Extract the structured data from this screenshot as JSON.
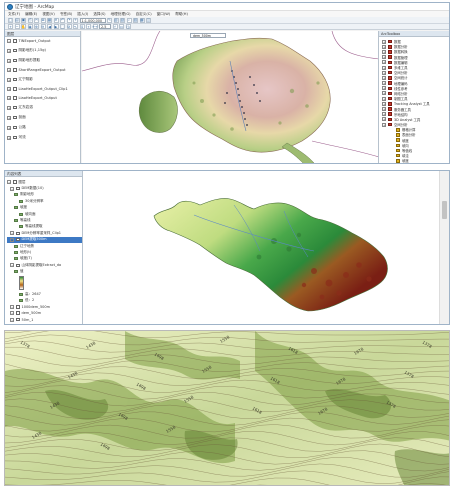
{
  "window": {
    "title": "辽宁地图 - ArcMap"
  },
  "menu": [
    "文件(F)",
    "编辑(E)",
    "视图(V)",
    "书签(B)",
    "插入(I)",
    "选择(S)",
    "地理处理(G)",
    "自定义(C)",
    "窗口(W)",
    "帮助(H)"
  ],
  "toolbar": {
    "scale": "1:1,000,000",
    "zoom_value": "2.5",
    "layer_selector": "dem_500m"
  },
  "toc1": {
    "title": "图层",
    "layers": [
      {
        "label": "TINExport_Output"
      },
      {
        "label": "阴影地形(1,15g)"
      },
      {
        "label": "阴影地形提取"
      },
      {
        "label": "ShortRangeExport_Output"
      },
      {
        "label": "辽宁阴影"
      },
      {
        "label": "LiaoHeExport_Output_Clip1"
      },
      {
        "label": "LiaoHeExport_Output"
      },
      {
        "label": "辽东岩溶"
      },
      {
        "label": "剖面"
      },
      {
        "label": "公路"
      },
      {
        "label": "河流"
      }
    ]
  },
  "arctoolbox": {
    "title": "ArcToolbox",
    "items": [
      {
        "label": "数据",
        "type": "box"
      },
      {
        "label": "数据分析",
        "type": "box"
      },
      {
        "label": "数据转换",
        "type": "box"
      },
      {
        "label": "数据管理",
        "type": "box"
      },
      {
        "label": "数据编辑",
        "type": "box"
      },
      {
        "label": "多维工具",
        "type": "box"
      },
      {
        "label": "空间分析",
        "type": "box"
      },
      {
        "label": "空间统计",
        "type": "box"
      },
      {
        "label": "地理编码",
        "type": "box"
      },
      {
        "label": "线性参考",
        "type": "box"
      },
      {
        "label": "网络分析",
        "type": "box"
      },
      {
        "label": "制图工具",
        "type": "box"
      },
      {
        "label": "Tracking Analyst 工具",
        "type": "box"
      },
      {
        "label": "服务器工具",
        "type": "box"
      },
      {
        "label": "宗地结构",
        "type": "box"
      },
      {
        "label": "3D Analyst 工具",
        "type": "box"
      },
      {
        "label": "空间分析",
        "type": "box"
      },
      {
        "label": "栅格计算",
        "type": "alt",
        "indent": true
      },
      {
        "label": "表面分析",
        "type": "alt",
        "indent": true
      },
      {
        "label": "坡度",
        "type": "alt",
        "indent": true
      },
      {
        "label": "坡向",
        "type": "alt",
        "indent": true
      },
      {
        "label": "等值线",
        "type": "alt",
        "indent": true
      },
      {
        "label": "填洼",
        "type": "alt",
        "indent": true
      },
      {
        "label": "坡度",
        "type": "alt",
        "indent": true
      },
      {
        "label": "地统计分析",
        "type": "box"
      }
    ]
  },
  "toc2": {
    "title": "内容列表",
    "rows": [
      {
        "label": "图层",
        "level": 0
      },
      {
        "label": "DEM数据(10)",
        "level": 1
      },
      {
        "label": "阴影地形",
        "level": 2
      },
      {
        "label": "30米分辨率",
        "level": 3
      },
      {
        "label": "坡度",
        "level": 2
      },
      {
        "label": "坡向面",
        "level": 3
      },
      {
        "label": "等高线",
        "level": 2
      },
      {
        "label": "等高线提取",
        "level": 3
      },
      {
        "label": "DEM分辨率重采样_Clip1",
        "level": 1
      },
      {
        "label": "DEM提取500m",
        "level": 1,
        "selected": true
      },
      {
        "label": "辽宁地势",
        "level": 2
      },
      {
        "label": "地形(t)",
        "level": 2
      },
      {
        "label": "坡度(T)",
        "level": 2
      },
      {
        "label": "山体阴影提取Extract_do",
        "level": 1
      },
      {
        "label": "值",
        "level": 2
      },
      {
        "label": "高：2647",
        "level": 3
      },
      {
        "label": "低：2",
        "level": 3
      },
      {
        "label": "1000dem_500m",
        "level": 1
      },
      {
        "label": "dem_500m",
        "level": 1
      },
      {
        "label": "50m_1",
        "level": 1
      },
      {
        "label": "10m",
        "level": 1
      },
      {
        "label": "山体",
        "level": 1
      }
    ]
  },
  "colors": {
    "window_border": "#9fb3c8",
    "panel_header": "#dde6ef",
    "selection": "#3d79c4",
    "terrain_low": "#2e8b3a",
    "terrain_mid": "#f0e28a",
    "terrain_high": "#b3651a",
    "relief_high": "#d9b3b3",
    "contour_light": "#eef1c6",
    "contour_dark": "#6f8f3a"
  },
  "contours": {
    "labels": [
      "1378",
      "1438",
      "1498",
      "1558",
      "1618",
      "1678",
      "1378",
      "1438",
      "1498",
      "1558",
      "1618",
      "1678",
      "1378",
      "1438",
      "1498",
      "1558",
      "1618",
      "1678",
      "1378",
      "1438",
      "1498",
      "1558"
    ]
  }
}
